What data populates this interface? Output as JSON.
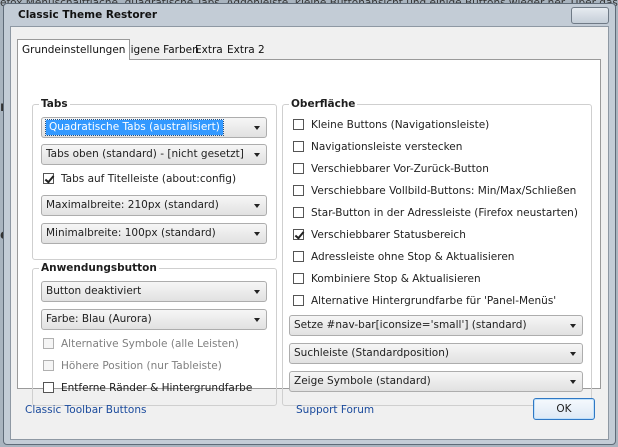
{
  "background": {
    "text": "efox Menüschaltfläche, quadratische Tabs, Addonleiste, kleine Buttonansicht und einige Buttons wieder her. Über das 'Anpassen'-Menü las",
    "edge1": "r",
    "edge2": "e"
  },
  "window": {
    "title": "Classic Theme Restorer"
  },
  "tabs": [
    {
      "label": "Grundeinstellungen",
      "active": true
    },
    {
      "label": "Eigene Farben",
      "active": false
    },
    {
      "label": "Extra",
      "active": false
    },
    {
      "label": "Extra 2",
      "active": false
    }
  ],
  "tabs_group": {
    "legend": "Tabs",
    "tab_style": "Quadratische Tabs (australisiert)",
    "tab_position": "Tabs oben (standard) - [nicht gesetzt]",
    "tabs_in_titlebar": {
      "label": "Tabs auf Titelleiste (about:config)",
      "checked": true
    },
    "max_width": "Maximalbreite: 210px (standard)",
    "min_width": "Minimalbreite: 100px (standard)"
  },
  "app_button_group": {
    "legend": "Anwendungsbutton",
    "button_mode": "Button deaktiviert",
    "color": "Farbe: Blau (Aurora)",
    "alt_symbols": {
      "label": "Alternative Symbole (alle Leisten)",
      "checked": false,
      "disabled": true
    },
    "higher_position": {
      "label": "Höhere Position (nur Tableiste)",
      "checked": false,
      "disabled": true
    },
    "remove_borders": {
      "label": "Entferne Ränder & Hintergrundfarbe",
      "checked": false,
      "disabled": false
    }
  },
  "surface_group": {
    "legend": "Oberfläche",
    "options": [
      {
        "label": "Kleine Buttons (Navigationsleiste)",
        "checked": false
      },
      {
        "label": "Navigationsleiste verstecken",
        "checked": false
      },
      {
        "label": "Verschiebbarer Vor-Zurück-Button",
        "checked": false
      },
      {
        "label": "Verschiebbare Vollbild-Buttons: Min/Max/Schließen",
        "checked": false
      },
      {
        "label": "Star-Button in der Adressleiste (Firefox neustarten)",
        "checked": false
      },
      {
        "label": "Verschiebbarer Statusbereich",
        "checked": true
      },
      {
        "label": "Adressleiste ohne Stop & Aktualisieren",
        "checked": false
      },
      {
        "label": "Kombiniere Stop & Aktualisieren",
        "checked": false
      },
      {
        "label": "Alternative Hintergrundfarbe für 'Panel-Menüs'",
        "checked": false
      }
    ],
    "navbar_iconsize": "Setze #nav-bar[iconsize='small'] (standard)",
    "search_bar": "Suchleiste (Standardposition)",
    "symbols": "Zeige Symbole (standard)"
  },
  "footer": {
    "link_left": "Classic Toolbar Buttons",
    "link_center": "Support Forum",
    "ok_label": "OK"
  },
  "colors": {
    "accent": "#3399ff",
    "link": "#1a4a9c"
  }
}
